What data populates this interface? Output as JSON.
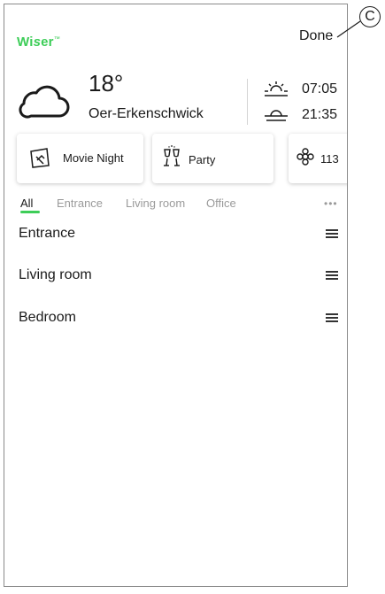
{
  "header": {
    "logo_left": "Wi",
    "logo_mid": "s",
    "logo_right": "er",
    "logo_tm": "™",
    "done_label": "Done",
    "callout_label": "C"
  },
  "weather": {
    "icon": "cloud-icon",
    "temperature": "18°",
    "city": "Oer-Erkenschwick",
    "sunrise_icon": "sunrise-icon",
    "sunrise": "07:05",
    "sunset_icon": "sunset-icon",
    "sunset": "21:35"
  },
  "moments": [
    {
      "label": "Movie Night",
      "icon": "movie-screen-icon"
    },
    {
      "label": "Party",
      "icon": "champagne-glasses-icon"
    },
    {
      "label": "113",
      "icon": "flower-icon"
    }
  ],
  "tabs": [
    {
      "label": "All",
      "active": true
    },
    {
      "label": "Entrance",
      "active": false
    },
    {
      "label": "Living room",
      "active": false
    },
    {
      "label": "Office",
      "active": false
    }
  ],
  "more_label": "•••",
  "rooms": [
    {
      "name": "Entrance"
    },
    {
      "name": "Living room"
    },
    {
      "name": "Bedroom"
    }
  ],
  "colors": {
    "accent": "#3dcd58",
    "text": "#1a1a1a",
    "muted": "#9a9a9a"
  }
}
